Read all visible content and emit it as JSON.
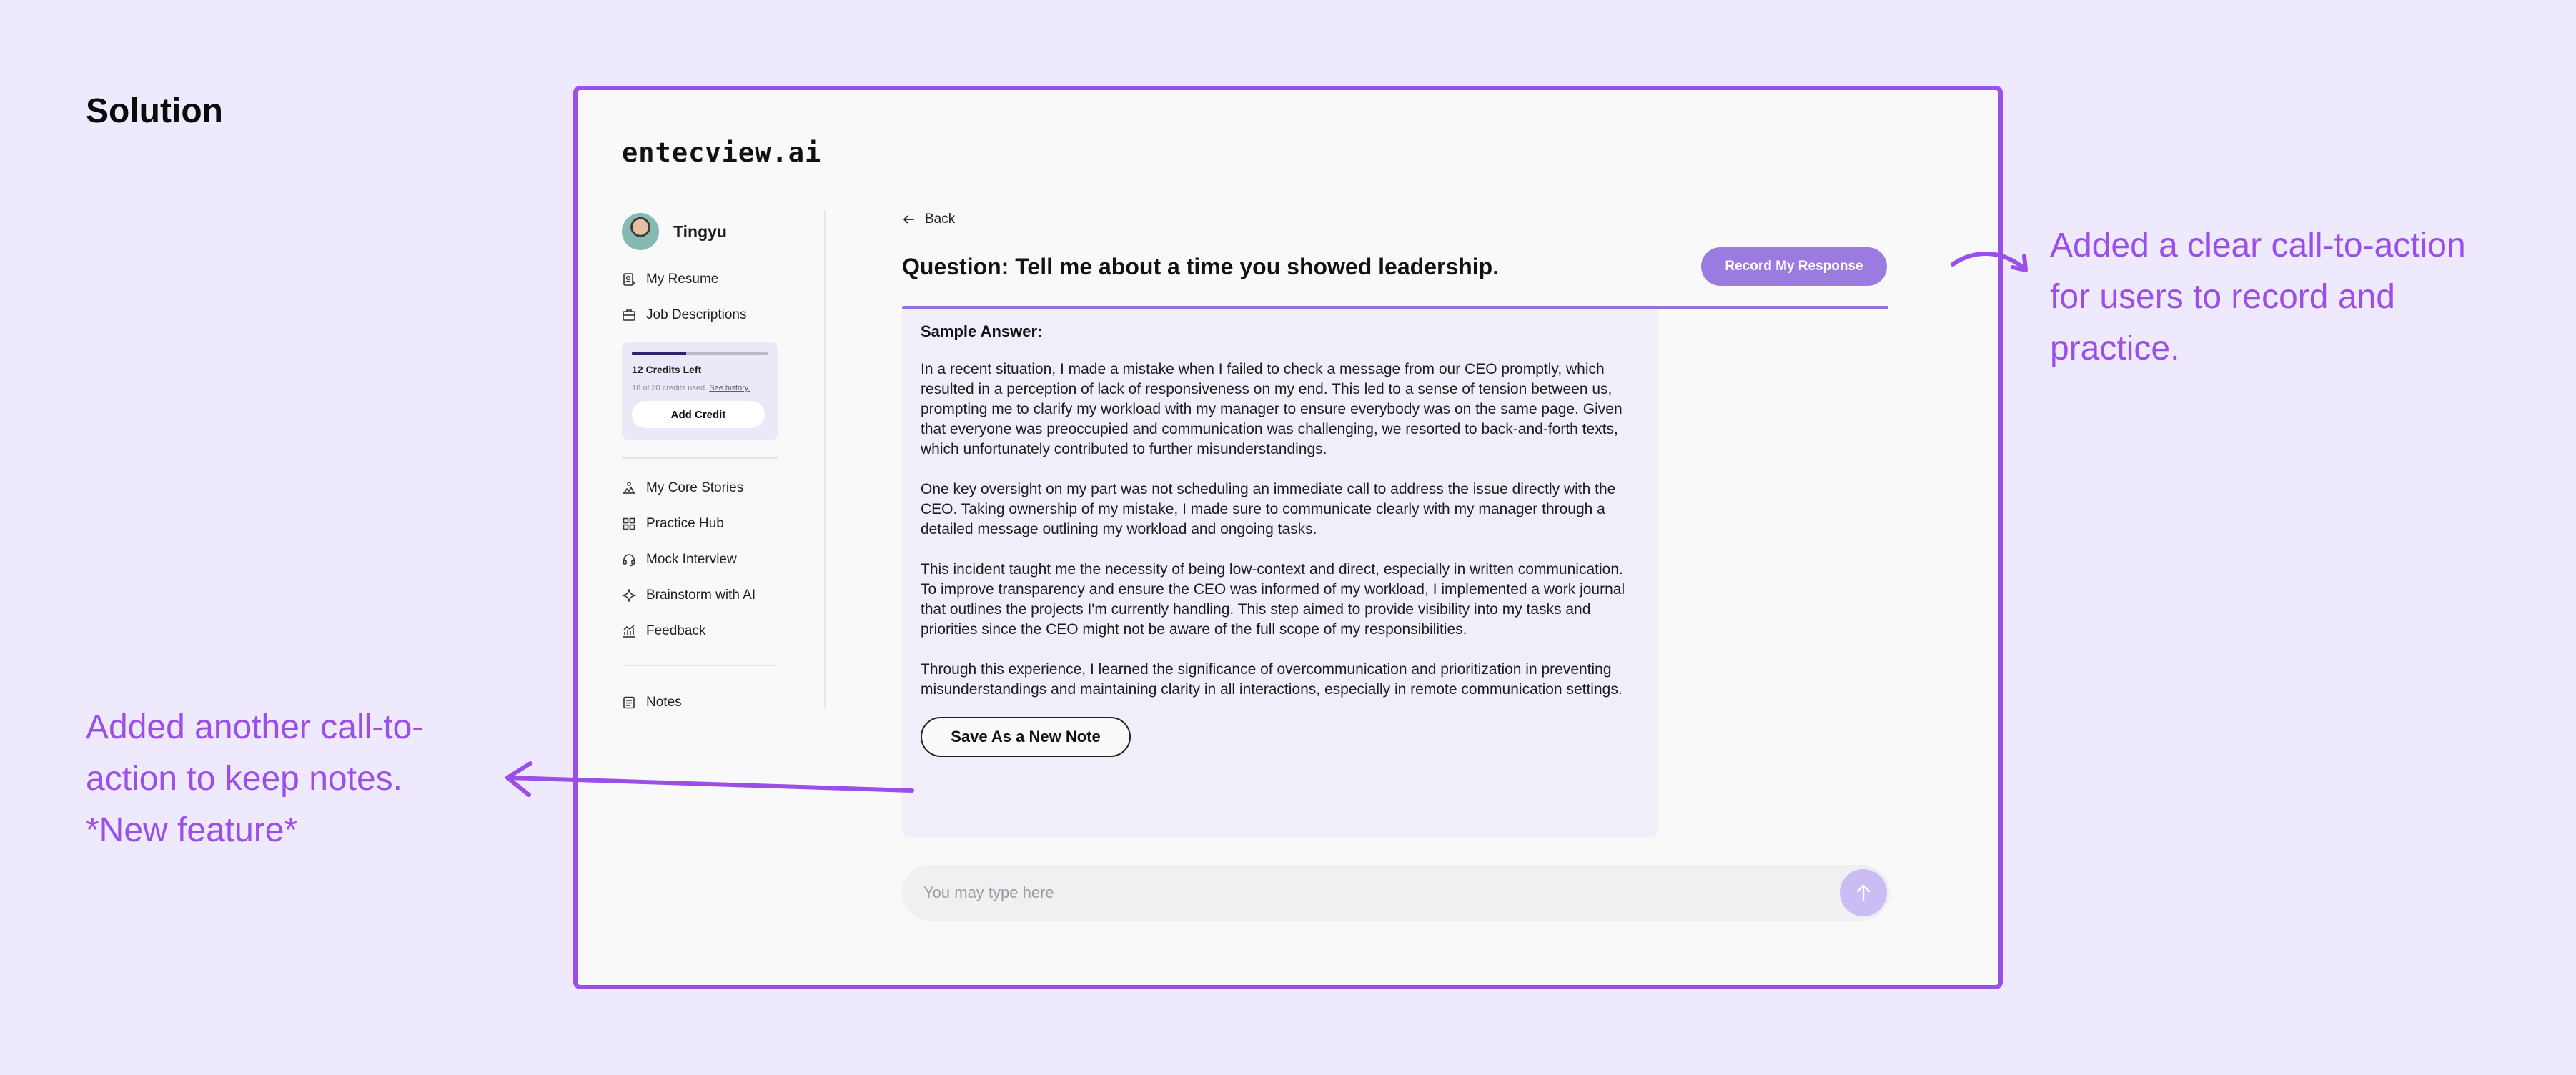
{
  "heading": "Solution",
  "app": {
    "logo": "entecview.ai",
    "user": {
      "name": "Tingyu"
    },
    "nav_top": [
      {
        "label": "My Resume",
        "icon": "resume-icon"
      },
      {
        "label": "Job Descriptions",
        "icon": "briefcase-icon"
      }
    ],
    "credits": {
      "title": "12 Credits Left",
      "used_text": "18 of 30 credits used.",
      "history_link": "See history.",
      "fraction_remaining": 0.4,
      "add_label": "Add Credit"
    },
    "nav_mid": [
      {
        "label": "My Core Stories",
        "icon": "stories-icon"
      },
      {
        "label": "Practice Hub",
        "icon": "grid-icon"
      },
      {
        "label": "Mock Interview",
        "icon": "headset-icon"
      },
      {
        "label": "Brainstorm with AI",
        "icon": "sparkle-icon"
      },
      {
        "label": "Feedback",
        "icon": "chart-icon"
      }
    ],
    "nav_bottom": [
      {
        "label": "Notes",
        "icon": "notes-icon"
      }
    ],
    "main": {
      "back_label": "Back",
      "question": "Question: Tell me about a time you showed leadership.",
      "record_button": "Record My Response",
      "answer_title": "Sample Answer:",
      "paragraphs": [
        "In a recent situation, I made a mistake when I failed to check a message from our CEO promptly, which resulted in a perception of lack of responsiveness on my end. This led to a sense of tension between us, prompting me to clarify my workload with my manager to ensure everybody was on the same page. Given that everyone was preoccupied and communication was challenging, we resorted to back-and-forth texts, which unfortunately contributed to further misunderstandings.",
        "One key oversight on my part was not scheduling an immediate call to address the issue directly with the CEO. Taking ownership of my mistake, I made sure to communicate clearly with my manager through a detailed message outlining my workload and ongoing tasks.",
        "This incident taught me the necessity of being low-context and direct, especially in written communication. To improve transparency and ensure the CEO was informed of my workload, I implemented a work journal that outlines the projects I'm currently handling. This step aimed to provide visibility into my tasks and priorities since the CEO might not be aware of the full scope of my responsibilities.",
        "Through this experience, I learned the significance of overcommunication and prioritization in preventing misunderstandings and maintaining clarity in all interactions, especially in remote communication settings."
      ],
      "save_note_button": "Save As a New Note",
      "input_placeholder": "You may type here"
    }
  },
  "annotations": {
    "right": "Added a clear call-to-action for users to record and practice.",
    "left_line1": "Added another call-to-action to keep notes.",
    "left_line2": "*New feature*"
  },
  "colors": {
    "background": "#efe9fd",
    "frame_border": "#9a4fe8",
    "annotation": "#9a4fe8",
    "record_button": "#9b7be0",
    "answer_bg": "#f1eefa"
  }
}
